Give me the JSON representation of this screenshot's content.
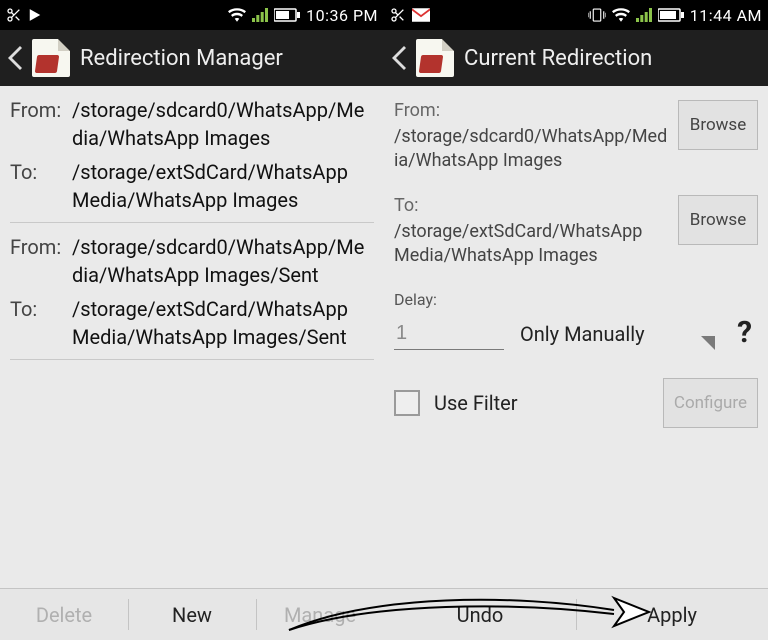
{
  "left": {
    "status": {
      "time": "10:36 PM"
    },
    "actionbar": {
      "title": "Redirection Manager"
    },
    "pairs": [
      {
        "from_label": "From:",
        "from_path": "/storage/sdcard0/WhatsApp/Media/WhatsApp Images",
        "to_label": "To:",
        "to_path": "/storage/extSdCard/WhatsApp Media/WhatsApp Images"
      },
      {
        "from_label": "From:",
        "from_path": "/storage/sdcard0/WhatsApp/Media/WhatsApp Images/Sent",
        "to_label": "To:",
        "to_path": "/storage/extSdCard/WhatsApp Media/WhatsApp Images/Sent"
      }
    ],
    "buttons": {
      "delete": "Delete",
      "new": "New",
      "manage": "Manage"
    }
  },
  "right": {
    "status": {
      "time": "11:44 AM"
    },
    "actionbar": {
      "title": "Current Redirection"
    },
    "from": {
      "label": "From:",
      "value": "/storage/sdcard0/WhatsApp/Media/WhatsApp Images",
      "browse": "Browse"
    },
    "to": {
      "label": "To:",
      "value": "/storage/extSdCard/WhatsApp Media/WhatsApp Images",
      "browse": "Browse"
    },
    "delay": {
      "label": "Delay:",
      "value": "1",
      "mode": "Only Manually",
      "help": "?"
    },
    "filter": {
      "label": "Use Filter",
      "checked": false,
      "configure": "Configure"
    },
    "buttons": {
      "undo": "Undo",
      "apply": "Apply"
    }
  }
}
